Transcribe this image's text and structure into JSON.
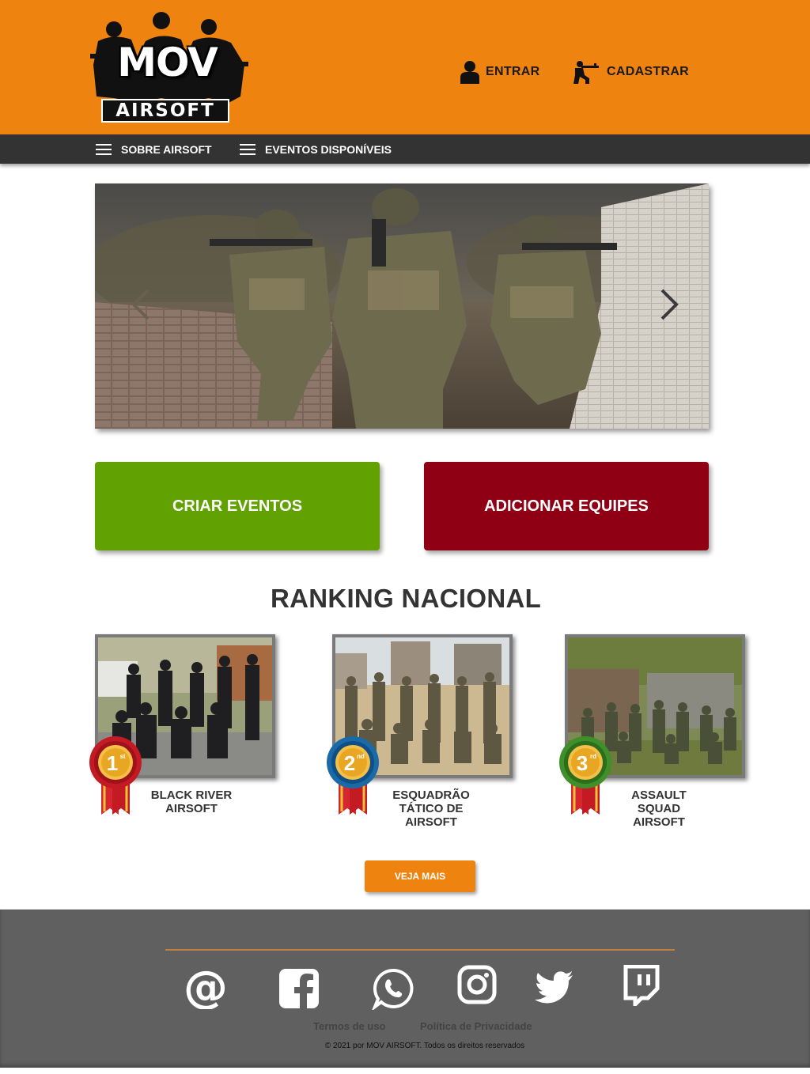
{
  "header": {
    "logo": {
      "top_text": "MOV",
      "bottom_text": "AIRSOFT"
    },
    "login_label": "ENTRAR",
    "register_label": "CADASTRAR",
    "background_color": "#ee840f"
  },
  "nav": {
    "items": [
      {
        "label": "SOBRE AIRSOFT",
        "icon": "menu-icon"
      },
      {
        "label": "EVENTOS DISPONÍVEIS",
        "icon": "menu-icon"
      }
    ],
    "background_color": "#333333"
  },
  "carousel": {
    "prev_icon": "chevron-left-icon",
    "next_icon": "chevron-right-icon"
  },
  "actions": {
    "create_events": "CRIAR EVENTOS",
    "add_teams": "ADICIONAR EQUIPES",
    "create_color": "#62a102",
    "teams_color": "#900014"
  },
  "ranking": {
    "title": "RANKING NACIONAL",
    "teams": [
      {
        "place": "1",
        "suffix": "st",
        "name": "BLACK RIVER AIRSOFT",
        "medal_color": "#c41a24"
      },
      {
        "place": "2",
        "suffix": "nd",
        "name": "ESQUADRÃO TÁTICO DE AIRSOFT",
        "medal_color": "#1a6aa8"
      },
      {
        "place": "3",
        "suffix": "rd",
        "name": "ASSAULT SQUAD AIRSOFT",
        "medal_color": "#3f8f2a"
      }
    ],
    "more_label": "VEJA MAIS",
    "more_color": "#ee840f"
  },
  "footer": {
    "social": [
      "email-icon",
      "facebook-icon",
      "whatsapp-icon",
      "instagram-icon",
      "twitter-icon",
      "twitch-icon"
    ],
    "terms_label": "Termos de uso",
    "privacy_label": "Política de Privacidade",
    "copyright": "© 2021 por MOV AIRSOFT.  Todos os direitos reservados",
    "background_color": "#606060"
  }
}
